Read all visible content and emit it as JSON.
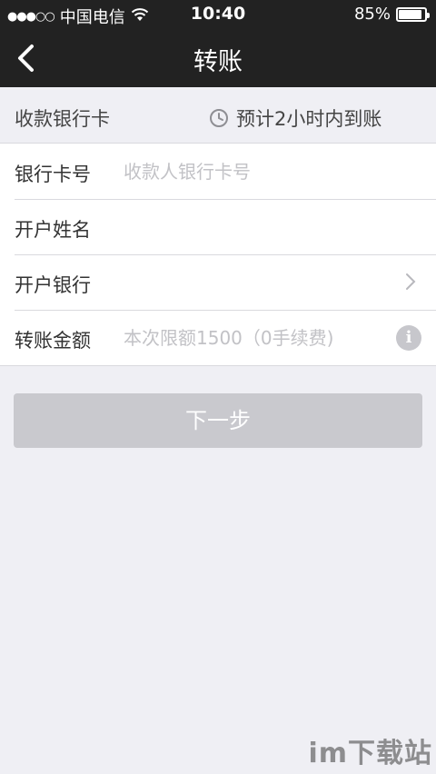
{
  "status_bar": {
    "signal": "●●●○○",
    "carrier": "中国电信",
    "time": "10:40",
    "battery": "85%"
  },
  "nav": {
    "title": "转账"
  },
  "info": {
    "label": "收款银行卡",
    "eta": "预计2小时内到账"
  },
  "form": {
    "card_number_label": "银行卡号",
    "card_number_placeholder": "收款人银行卡号",
    "name_label": "开户姓名",
    "bank_label": "开户银行",
    "amount_label": "转账金额",
    "amount_placeholder": "本次限额1500（0手续费)"
  },
  "actions": {
    "next_label": "下一步"
  },
  "watermark": "im下载站"
}
